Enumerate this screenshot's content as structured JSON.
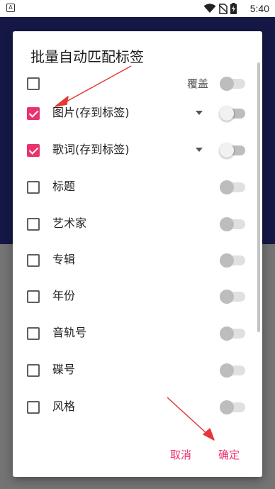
{
  "status_bar": {
    "a_icon_letter": "A",
    "time": "5:40"
  },
  "dialog": {
    "title": "批量自动匹配标签",
    "overwrite_label": "覆盖",
    "rows": [
      {
        "label": "图片(存到标签)",
        "checked": true,
        "has_dropdown": true,
        "switch_on": false
      },
      {
        "label": "歌词(存到标签)",
        "checked": true,
        "has_dropdown": true,
        "switch_on": false
      },
      {
        "label": "标题",
        "checked": false,
        "has_dropdown": false,
        "switch_on": false
      },
      {
        "label": "艺术家",
        "checked": false,
        "has_dropdown": false,
        "switch_on": false
      },
      {
        "label": "专辑",
        "checked": false,
        "has_dropdown": false,
        "switch_on": false
      },
      {
        "label": "年份",
        "checked": false,
        "has_dropdown": false,
        "switch_on": false
      },
      {
        "label": "音轨号",
        "checked": false,
        "has_dropdown": false,
        "switch_on": false
      },
      {
        "label": "碟号",
        "checked": false,
        "has_dropdown": false,
        "switch_on": false
      },
      {
        "label": "风格",
        "checked": false,
        "has_dropdown": false,
        "switch_on": false
      }
    ],
    "cancel_label": "取消",
    "confirm_label": "确定"
  },
  "colors": {
    "accent": "#e8336d",
    "header_bg": "#151846",
    "scrim": "#747474",
    "annotation_arrow": "#e53935"
  }
}
